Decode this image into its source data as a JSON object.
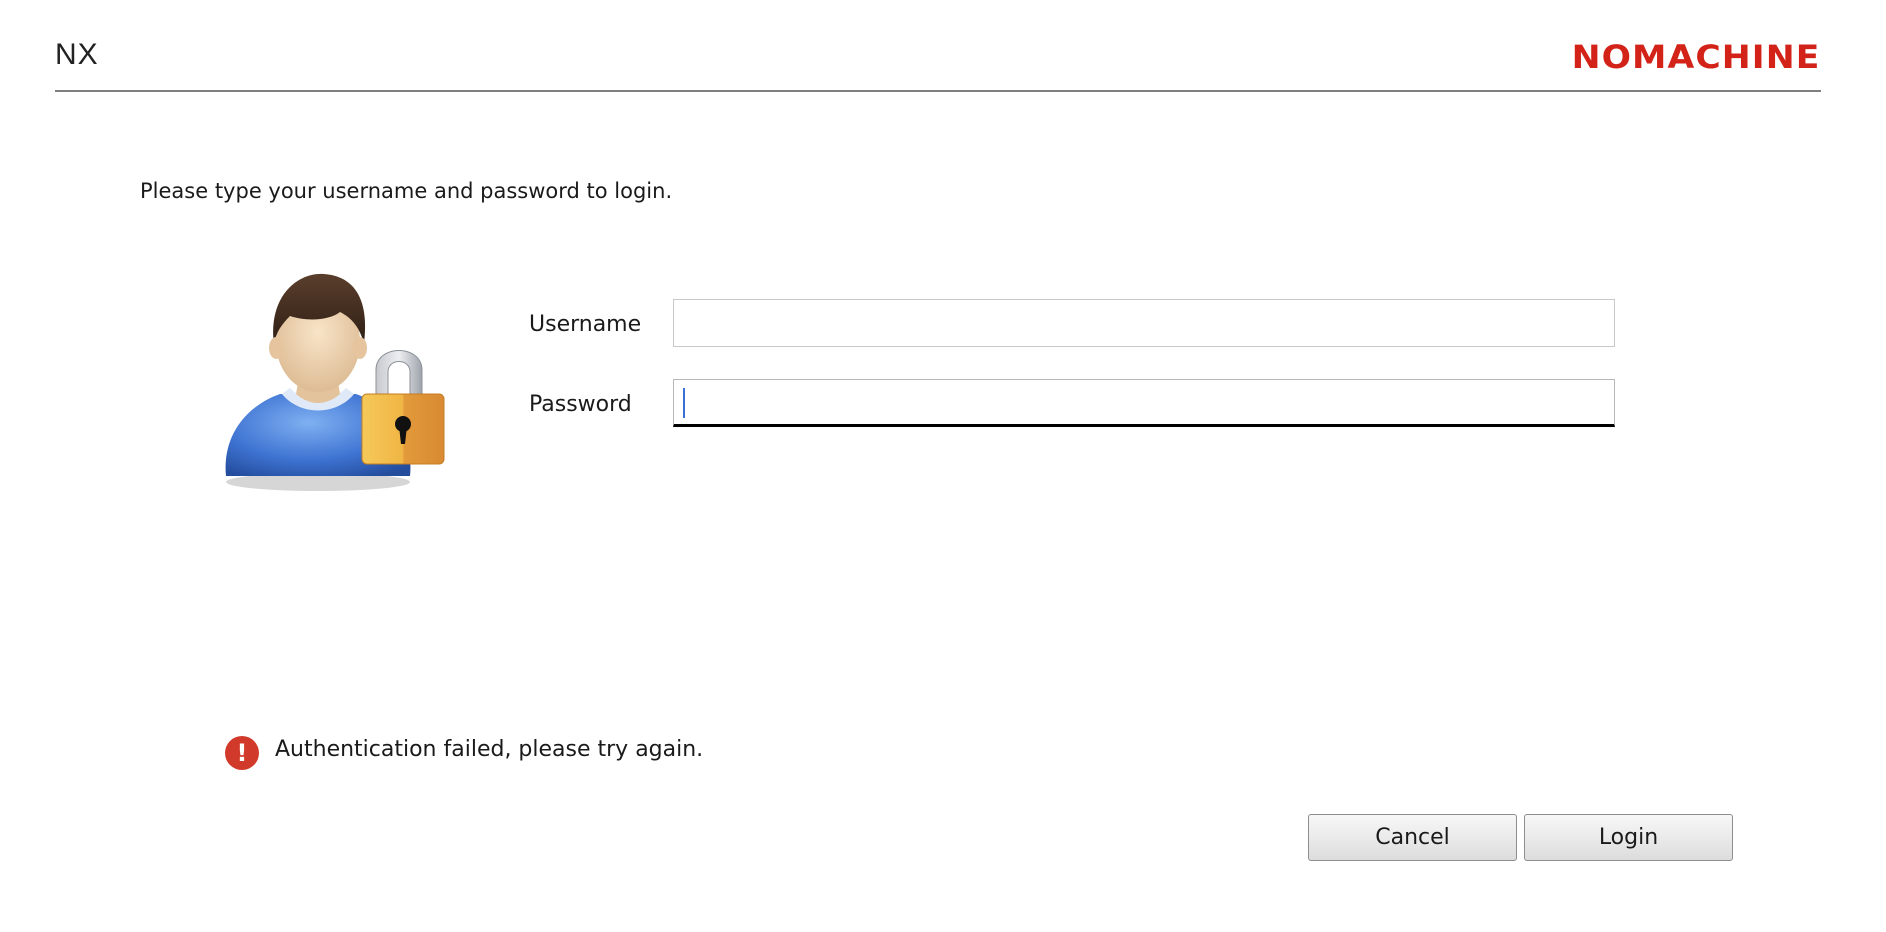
{
  "header": {
    "app_title": "NX",
    "brand": "NOMACHINE"
  },
  "prompt": {
    "instruction": "Please type your username and password to login."
  },
  "form": {
    "username": {
      "label": "Username",
      "value": ""
    },
    "password": {
      "label": "Password",
      "value": ""
    }
  },
  "status": {
    "error_message": "Authentication failed, please try again.",
    "error_icon_glyph": "!"
  },
  "buttons": {
    "cancel": "Cancel",
    "login": "Login"
  },
  "colors": {
    "brand_red": "#d32218",
    "error_red": "#d13a2a",
    "avatar_shirt": "#4a7fd8",
    "padlock_gold": "#e8a93a"
  }
}
